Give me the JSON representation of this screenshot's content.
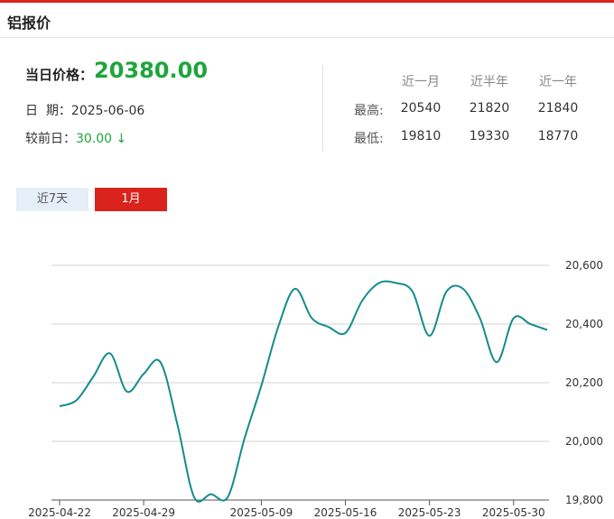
{
  "header": {
    "title": "铝报价"
  },
  "quote": {
    "price_label": "当日价格：",
    "price": "20380.00",
    "date_label": "日  期：",
    "date": "2025-06-06",
    "change_label": "较前日：",
    "change": "30.00",
    "change_arrow": "↓"
  },
  "stats": {
    "headers": [
      "近一月",
      "近半年",
      "近一年"
    ],
    "high_label": "最高:",
    "low_label": "最低:",
    "high": [
      "20540",
      "21820",
      "21840"
    ],
    "low": [
      "19810",
      "19330",
      "18770"
    ]
  },
  "tabs": [
    {
      "label": "近7天",
      "active": false
    },
    {
      "label": "1月",
      "active": true
    }
  ],
  "colors": {
    "accent": "#d9231c",
    "up_green": "#1ea53c",
    "line": "#148c8c"
  },
  "chart_data": {
    "type": "line",
    "title": "",
    "xlabel": "",
    "ylabel": "",
    "ylim": [
      19800,
      20600
    ],
    "y_ticks": [
      "19,800",
      "20,000",
      "20,200",
      "20,400",
      "20,600"
    ],
    "y_tick_values": [
      19800,
      20000,
      20200,
      20400,
      20600
    ],
    "x_tick_labels": [
      "2025-04-22",
      "2025-04-29",
      "2025-05-09",
      "2025-05-16",
      "2025-05-23",
      "2025-05-30"
    ],
    "x_tick_index": [
      0,
      5,
      12,
      17,
      22,
      27
    ],
    "grid": true,
    "x": [
      "2025-04-22",
      "2025-04-23",
      "2025-04-24",
      "2025-04-25",
      "2025-04-28",
      "2025-04-29",
      "2025-04-30",
      "2025-05-06",
      "2025-05-07",
      "2025-05-08",
      "2025-05-09",
      "2025-05-12",
      "2025-05-13",
      "2025-05-14",
      "2025-05-15",
      "2025-05-16",
      "2025-05-19",
      "2025-05-20",
      "2025-05-21",
      "2025-05-22",
      "2025-05-23",
      "2025-05-26",
      "2025-05-27",
      "2025-05-28",
      "2025-05-29",
      "2025-05-30",
      "2025-06-03",
      "2025-06-04",
      "2025-06-05",
      "2025-06-06"
    ],
    "series": [
      {
        "values": [
          20120,
          20140,
          20220,
          20300,
          20170,
          20230,
          20270,
          20060,
          19810,
          19820,
          19810,
          20010,
          20190,
          20390,
          20520,
          20420,
          20390,
          20370,
          20480,
          20540,
          20540,
          20510,
          20360,
          20510,
          20520,
          20420,
          20270,
          20420,
          20400,
          20380
        ]
      }
    ]
  }
}
